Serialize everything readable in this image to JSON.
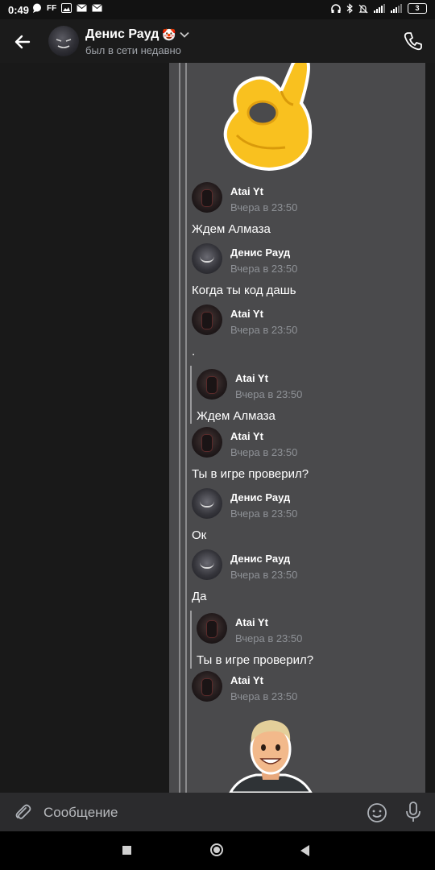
{
  "status_bar": {
    "time": "0:49",
    "battery": "3"
  },
  "header": {
    "name": "Денис Рауд",
    "name_emoji": "🤡",
    "status": "был в сети недавно"
  },
  "messages": [
    {
      "author": "Atai Yt",
      "time": "Вчера в 23:50",
      "text": "Ждем Алмаза"
    },
    {
      "author": "Денис Рауд",
      "time": "Вчера в 23:50",
      "text": "Когда ты код дашь"
    },
    {
      "author": "Atai Yt",
      "time": "Вчера в 23:50",
      "text": "."
    },
    {
      "author": "Atai Yt",
      "time": "Вчера в 23:50",
      "text": "Ждем Алмаза"
    },
    {
      "author": "Atai Yt",
      "time": "Вчера в 23:50",
      "text": "Ты в игре проверил?"
    },
    {
      "author": "Денис Рауд",
      "time": "Вчера в 23:50",
      "text": "Ок"
    },
    {
      "author": "Денис Рауд",
      "time": "Вчера в 23:50",
      "text": "Да"
    },
    {
      "author": "Atai Yt",
      "time": "Вчера в 23:50",
      "text": "Ты в игре проверил?"
    },
    {
      "author": "Atai Yt",
      "time": "Вчера в 23:50",
      "text": ""
    }
  ],
  "stickers": {
    "top": "ok-hand-sticker",
    "bottom": "cartoon-man-sticker"
  },
  "composer": {
    "placeholder": "Сообщение"
  },
  "icons": {
    "back": "arrow-left-icon",
    "phone": "phone-icon",
    "attach": "paperclip-icon",
    "emoji": "smile-icon",
    "mic": "microphone-icon",
    "scroll": "chevron-down-icon"
  },
  "colors": {
    "panel": "#4a4a4c",
    "background": "#191919",
    "composer": "#2b2b2d"
  }
}
